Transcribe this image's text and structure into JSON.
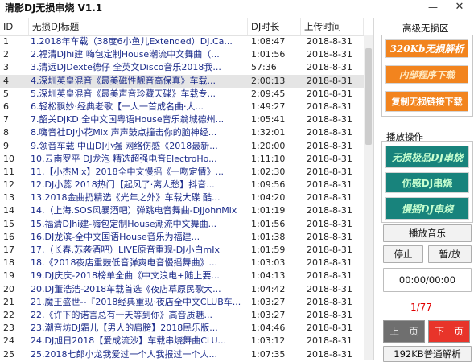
{
  "app": {
    "title": "清影DJ无损串烧 V1.1",
    "minimize_glyph": "—",
    "close_glyph": "✕"
  },
  "table": {
    "columns": [
      "ID",
      "无损DJ标题",
      "DJ时长",
      "上传时间"
    ],
    "rows": [
      {
        "id": "1",
        "title": "1.2018年车载（38度6小鱼儿Extended）DJ.Ca...",
        "duration": "1:08:47",
        "date": "2018-8-31"
      },
      {
        "id": "2",
        "title": "2.福清DJhi建 嗨包定制House潮流中文舞曲（...",
        "duration": "1:01:56",
        "date": "2018-8-31"
      },
      {
        "id": "3",
        "title": "3.清远DJDexte德仔 全英文Disco音乐2018我...",
        "duration": "57:36",
        "date": "2018-8-31"
      },
      {
        "id": "4",
        "title": "4.深圳英皇混音《最美磁性靓音高保真》车载...",
        "duration": "2:00:13",
        "date": "2018-8-31"
      },
      {
        "id": "5",
        "title": "5.深圳英皇混音《最美声音珍藏天碟》车载专...",
        "duration": "2:09:45",
        "date": "2018-8-31"
      },
      {
        "id": "6",
        "title": "6.轻松飘妙·经典老歌【一人一首成名曲·大...",
        "duration": "1:49:27",
        "date": "2018-8-31"
      },
      {
        "id": "7",
        "title": "7.韶关DjKD 全中文国粤语House音乐翁城德州...",
        "duration": "1:05:41",
        "date": "2018-8-31"
      },
      {
        "id": "8",
        "title": "8.嗨音社DJ小花Mix 声声鼓点撞击你的脑神经...",
        "duration": "1:32:01",
        "date": "2018-8-31"
      },
      {
        "id": "9",
        "title": "9.领音车载 中山DJ小强 网络伤感《2018最新...",
        "duration": "1:20:00",
        "date": "2018-8-31"
      },
      {
        "id": "10",
        "title": "10.云南罗平 DJ龙泡 精选超强电音ElectroHo...",
        "duration": "1:11:10",
        "date": "2018-8-31"
      },
      {
        "id": "11",
        "title": "11.【小杰Mix】2018全中文慢摇《一吻定情》...",
        "duration": "1:02:30",
        "date": "2018-8-31"
      },
      {
        "id": "12",
        "title": "12.DJ小蕊 2018热门【起风了·离人愁】抖音...",
        "duration": "1:09:56",
        "date": "2018-8-31"
      },
      {
        "id": "13",
        "title": "13.2018金曲扔精选《光年之外》车载大碟 酷...",
        "duration": "1:04:20",
        "date": "2018-8-31"
      },
      {
        "id": "14",
        "title": "14.（上海.SOS风暴酒吧）弹跳电音舞曲-DJJohnMix",
        "duration": "1:01:19",
        "date": "2018-8-31"
      },
      {
        "id": "15",
        "title": "15.福清DJhi建-嗨包定制House潮流中文舞曲...",
        "duration": "1:01:56",
        "date": "2018-8-31"
      },
      {
        "id": "16",
        "title": "16.DJ龙滨-全中文国语House音乐为福建...",
        "duration": "1:01:38",
        "date": "2018-8-31"
      },
      {
        "id": "17",
        "title": "17.（长春.苏袭酒吧）LIVE原音重现-DJ小白mIx",
        "duration": "1:01:59",
        "date": "2018-8-31"
      },
      {
        "id": "18",
        "title": "18.《2018夜店重鼓低音弹爽电音慢摇舞曲》...",
        "duration": "1:03:03",
        "date": "2018-8-31"
      },
      {
        "id": "19",
        "title": "19.DJ庆庆-2018榜单全曲《中文浪电+随上要...",
        "duration": "1:04:13",
        "date": "2018-8-31"
      },
      {
        "id": "20",
        "title": "20.DJ董浩浩-2018车载首选《夜店草原民歌大...",
        "duration": "1:04:42",
        "date": "2018-8-31"
      },
      {
        "id": "21",
        "title": "21.魔王盛世--『2018经典重现·夜店全中文CLUB车...",
        "duration": "1:03:27",
        "date": "2018-8-31"
      },
      {
        "id": "22",
        "title": "22.《许下的诺言总有一天等到你》高音质魅...",
        "duration": "1:03:27",
        "date": "2018-8-31"
      },
      {
        "id": "23",
        "title": "23.潮音坊DJ霜儿【男人的肩膀】2018民乐版...",
        "duration": "1:04:46",
        "date": "2018-8-31"
      },
      {
        "id": "24",
        "title": "24.DJ旭日2018【爱成流沙】车载串烧舞曲CLU...",
        "duration": "1:03:12",
        "date": "2018-8-31"
      },
      {
        "id": "25",
        "title": "25.2018七郎小龙我爱过一个人我报过一个人...",
        "duration": "1:07:35",
        "date": "2018-8-31"
      }
    ],
    "selected_row": 3
  },
  "panel": {
    "quality_group_label": "高级无损区",
    "btn_320kb": "320Kb无损解析",
    "btn_internal": "内部程序下载",
    "btn_copy_link": "复制无损链接下载",
    "play_group_label": "播放操作",
    "btn_lossless_series": "无损极品DJ串烧",
    "btn_sad_dj": "伤感DJ串烧",
    "btn_slow_dj": "慢摇DJ串烧",
    "btn_play_music": "播放音乐",
    "btn_stop": "停止",
    "btn_pause": "暂/放",
    "time_display": "00:00/00:00",
    "page_indicator": "1/77",
    "btn_prev_page": "上一页",
    "btn_next_page": "下一页",
    "btn_192kb": "192KB普通解析"
  },
  "colors": {
    "accent_orange": "#f2841e",
    "teal": "#18837c",
    "prev_gray": "#6f6f6f",
    "next_red": "#e8342a",
    "title_blue": "#1a2a8a"
  }
}
